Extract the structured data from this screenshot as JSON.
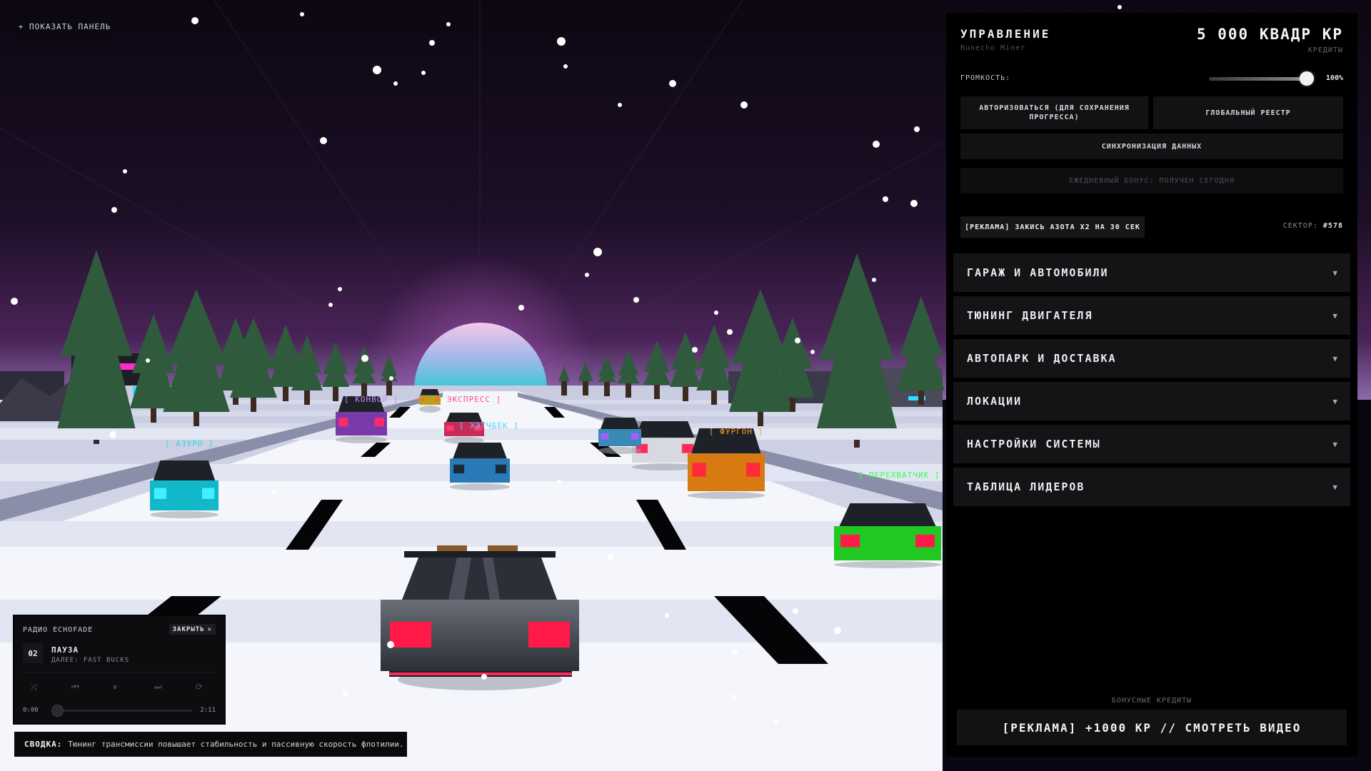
{
  "show_panel": {
    "label": "+ ПОКАЗАТЬ ПАНЕЛЬ"
  },
  "scene": {
    "car_tags": [
      {
        "label": "[ КОНВОЙ ]",
        "color": "#c28cff"
      },
      {
        "label": "ЭКСПРЕСС ]",
        "color": "#ff4d7d"
      },
      {
        "label": "[ ХЭТЧБЕК ]",
        "color": "#4dd3ff"
      },
      {
        "label": "[ АЗУРО ]",
        "color": "#28d8e8"
      },
      {
        "label": "[ ФУРГОН ]",
        "color": "#ff9a2a"
      },
      {
        "label": "[ ПЕРЕХВАТЧИК ]",
        "color": "#39ff4a"
      }
    ]
  },
  "panel": {
    "title": "УПРАВЛЕНИЕ",
    "subtitle": "Runecho Miner",
    "credits_value": "5 000 КВАДР КР",
    "credits_label": "КРЕДИТЫ",
    "volume_label": "ГРОМКОСТЬ:",
    "volume_value": "100%",
    "volume_level": 1.0,
    "btn_auth": "АВТОРИЗОВАТЬСЯ (ДЛЯ СОХРАНЕНИЯ ПРОГРЕССА)",
    "btn_registry": "ГЛОБАЛЬНЫЙ РЕЕСТР",
    "btn_sync": "СИНХРОНИЗАЦИЯ ДАННЫХ",
    "btn_daily": "ЕЖЕДНЕВНЫЙ БОНУС: ПОЛУЧЕН СЕГОДНЯ",
    "btn_nitro": "[РЕКЛАМА] ЗАКИСЬ АЗОТА X2 НА 30 СЕК",
    "sector_label": "СЕКТОР:",
    "sector_value": "#578",
    "sections": [
      {
        "label": "ГАРАЖ И АВТОМОБИЛИ"
      },
      {
        "label": "ТЮНИНГ ДВИГАТЕЛЯ"
      },
      {
        "label": "АВТОПАРК И ДОСТАВКА"
      },
      {
        "label": "ЛОКАЦИИ"
      },
      {
        "label": "НАСТРОЙКИ СИСТЕМЫ"
      },
      {
        "label": "ТАБЛИЦА ЛИДЕРОВ"
      }
    ],
    "chevron": "▼",
    "bonus_label": "БОНУСНЫЕ КРЕДИТЫ",
    "btn_video": "[РЕКЛАМА] +1000 КР // СМОТРЕТЬ ВИДЕО"
  },
  "radio": {
    "title": "РАДИО ECHOFADE",
    "close_label": "ЗАКРЫТЬ",
    "close_icon": "✕",
    "track_number": "02",
    "status": "ПАУЗА",
    "next": "ДАЛЕЕ: FAST BUCKS",
    "time_current": "0:00",
    "time_total": "2:11",
    "progress": 0
  },
  "summary": {
    "label": "СВОДКА:",
    "text": "Тюнинг трансмиссии повышает стабильность и пассивную скорость флотилии."
  },
  "colors": {
    "sky_top": "#0d0814",
    "sky_horizon": "#5a2a6a",
    "sun_top": "#f0b8e0",
    "sun_bottom": "#40c8d8",
    "tree": "#2e5a3a",
    "road": "#f4f6fb"
  }
}
